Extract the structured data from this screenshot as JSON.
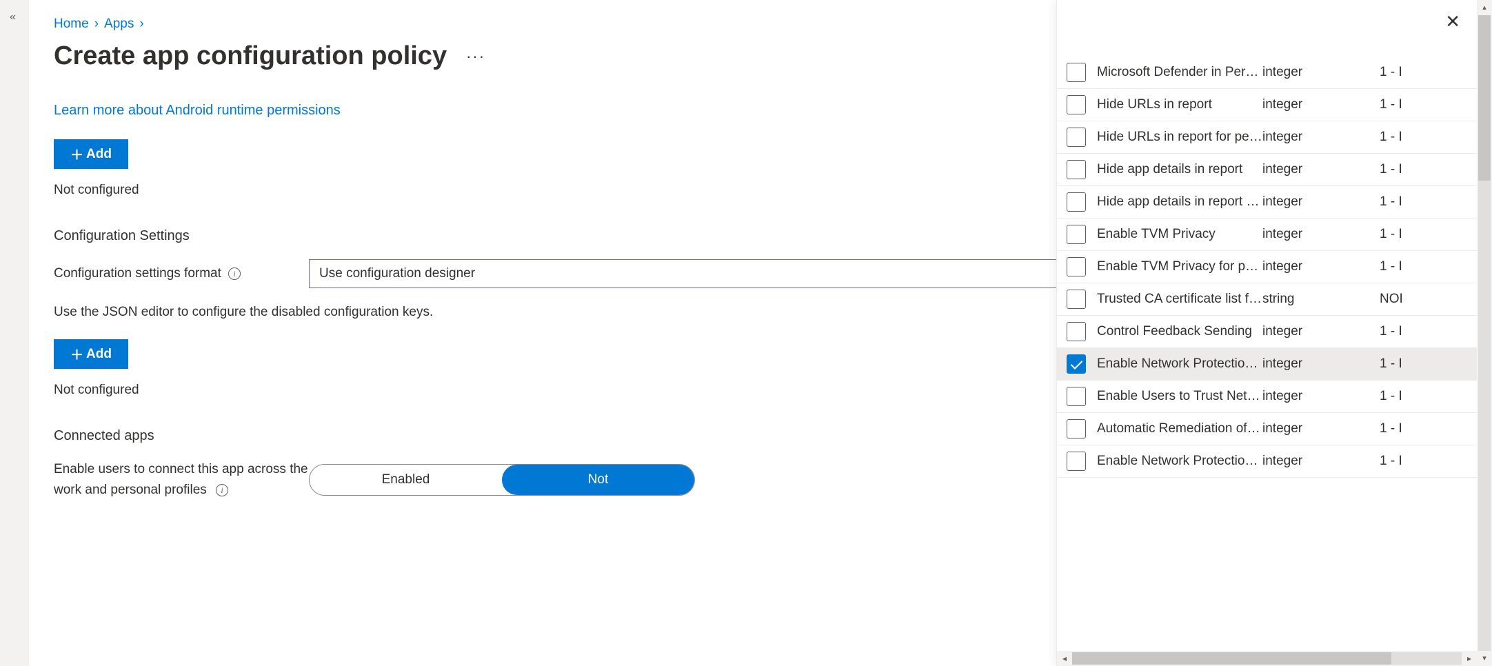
{
  "breadcrumb": {
    "home": "Home",
    "apps": "Apps"
  },
  "page": {
    "title": "Create app configuration policy",
    "learn_link": "Learn more about Android runtime permissions",
    "add_label": "Add",
    "not_configured": "Not configured",
    "config_settings_heading": "Configuration Settings",
    "format_label": "Configuration settings format",
    "format_value": "Use configuration designer",
    "json_helper": "Use the JSON editor to configure the disabled configuration keys.",
    "connected_apps_heading": "Connected apps",
    "connected_apps_desc": "Enable users to connect this app across the work and personal profiles",
    "toggle_enabled": "Enabled",
    "toggle_not": "Not"
  },
  "flyout": {
    "rows": [
      {
        "key": "Microsoft Defender in Perso…",
        "type": "integer",
        "val": "1 - I",
        "checked": false
      },
      {
        "key": "Hide URLs in report",
        "type": "integer",
        "val": "1 - I",
        "checked": false
      },
      {
        "key": "Hide URLs in report for pers…",
        "type": "integer",
        "val": "1 - I",
        "checked": false
      },
      {
        "key": "Hide app details in report",
        "type": "integer",
        "val": "1 - I",
        "checked": false
      },
      {
        "key": "Hide app details in report f…",
        "type": "integer",
        "val": "1 - I",
        "checked": false
      },
      {
        "key": "Enable TVM Privacy",
        "type": "integer",
        "val": "1 - I",
        "checked": false
      },
      {
        "key": "Enable TVM Privacy for pers…",
        "type": "integer",
        "val": "1 - I",
        "checked": false
      },
      {
        "key": "Trusted CA certificate list for…",
        "type": "string",
        "val": "NOI",
        "checked": false
      },
      {
        "key": "Control Feedback Sending",
        "type": "integer",
        "val": "1 - I",
        "checked": false
      },
      {
        "key": "Enable Network Protection i…",
        "type": "integer",
        "val": "1 - I",
        "checked": true
      },
      {
        "key": "Enable Users to Trust Netwo…",
        "type": "integer",
        "val": "1 - I",
        "checked": false
      },
      {
        "key": "Automatic Remediation of …",
        "type": "integer",
        "val": "1 - I",
        "checked": false
      },
      {
        "key": "Enable Network Protection …",
        "type": "integer",
        "val": "1 - I",
        "checked": false
      }
    ]
  }
}
